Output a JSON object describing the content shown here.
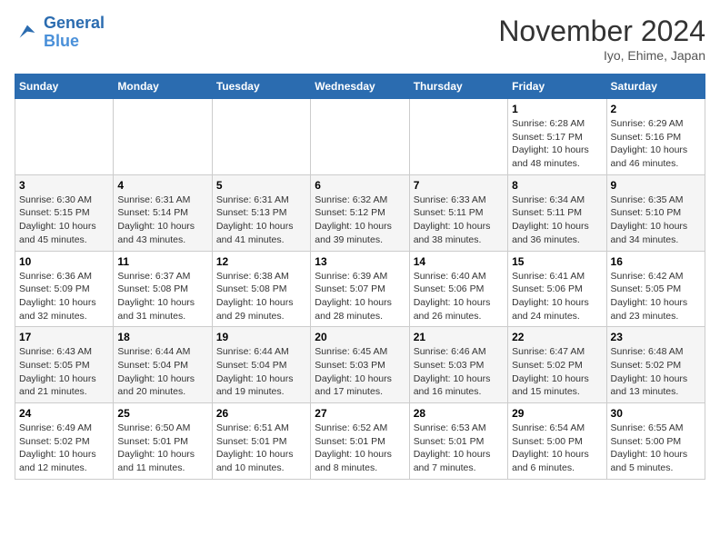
{
  "logo": {
    "line1": "General",
    "line2": "Blue"
  },
  "header": {
    "month": "November 2024",
    "location": "Iyo, Ehime, Japan"
  },
  "weekdays": [
    "Sunday",
    "Monday",
    "Tuesday",
    "Wednesday",
    "Thursday",
    "Friday",
    "Saturday"
  ],
  "weeks": [
    [
      null,
      null,
      null,
      null,
      null,
      {
        "day": "1",
        "sunrise": "6:28 AM",
        "sunset": "5:17 PM",
        "daylight": "10 hours and 48 minutes."
      },
      {
        "day": "2",
        "sunrise": "6:29 AM",
        "sunset": "5:16 PM",
        "daylight": "10 hours and 46 minutes."
      }
    ],
    [
      {
        "day": "3",
        "sunrise": "6:30 AM",
        "sunset": "5:15 PM",
        "daylight": "10 hours and 45 minutes."
      },
      {
        "day": "4",
        "sunrise": "6:31 AM",
        "sunset": "5:14 PM",
        "daylight": "10 hours and 43 minutes."
      },
      {
        "day": "5",
        "sunrise": "6:31 AM",
        "sunset": "5:13 PM",
        "daylight": "10 hours and 41 minutes."
      },
      {
        "day": "6",
        "sunrise": "6:32 AM",
        "sunset": "5:12 PM",
        "daylight": "10 hours and 39 minutes."
      },
      {
        "day": "7",
        "sunrise": "6:33 AM",
        "sunset": "5:11 PM",
        "daylight": "10 hours and 38 minutes."
      },
      {
        "day": "8",
        "sunrise": "6:34 AM",
        "sunset": "5:11 PM",
        "daylight": "10 hours and 36 minutes."
      },
      {
        "day": "9",
        "sunrise": "6:35 AM",
        "sunset": "5:10 PM",
        "daylight": "10 hours and 34 minutes."
      }
    ],
    [
      {
        "day": "10",
        "sunrise": "6:36 AM",
        "sunset": "5:09 PM",
        "daylight": "10 hours and 32 minutes."
      },
      {
        "day": "11",
        "sunrise": "6:37 AM",
        "sunset": "5:08 PM",
        "daylight": "10 hours and 31 minutes."
      },
      {
        "day": "12",
        "sunrise": "6:38 AM",
        "sunset": "5:08 PM",
        "daylight": "10 hours and 29 minutes."
      },
      {
        "day": "13",
        "sunrise": "6:39 AM",
        "sunset": "5:07 PM",
        "daylight": "10 hours and 28 minutes."
      },
      {
        "day": "14",
        "sunrise": "6:40 AM",
        "sunset": "5:06 PM",
        "daylight": "10 hours and 26 minutes."
      },
      {
        "day": "15",
        "sunrise": "6:41 AM",
        "sunset": "5:06 PM",
        "daylight": "10 hours and 24 minutes."
      },
      {
        "day": "16",
        "sunrise": "6:42 AM",
        "sunset": "5:05 PM",
        "daylight": "10 hours and 23 minutes."
      }
    ],
    [
      {
        "day": "17",
        "sunrise": "6:43 AM",
        "sunset": "5:05 PM",
        "daylight": "10 hours and 21 minutes."
      },
      {
        "day": "18",
        "sunrise": "6:44 AM",
        "sunset": "5:04 PM",
        "daylight": "10 hours and 20 minutes."
      },
      {
        "day": "19",
        "sunrise": "6:44 AM",
        "sunset": "5:04 PM",
        "daylight": "10 hours and 19 minutes."
      },
      {
        "day": "20",
        "sunrise": "6:45 AM",
        "sunset": "5:03 PM",
        "daylight": "10 hours and 17 minutes."
      },
      {
        "day": "21",
        "sunrise": "6:46 AM",
        "sunset": "5:03 PM",
        "daylight": "10 hours and 16 minutes."
      },
      {
        "day": "22",
        "sunrise": "6:47 AM",
        "sunset": "5:02 PM",
        "daylight": "10 hours and 15 minutes."
      },
      {
        "day": "23",
        "sunrise": "6:48 AM",
        "sunset": "5:02 PM",
        "daylight": "10 hours and 13 minutes."
      }
    ],
    [
      {
        "day": "24",
        "sunrise": "6:49 AM",
        "sunset": "5:02 PM",
        "daylight": "10 hours and 12 minutes."
      },
      {
        "day": "25",
        "sunrise": "6:50 AM",
        "sunset": "5:01 PM",
        "daylight": "10 hours and 11 minutes."
      },
      {
        "day": "26",
        "sunrise": "6:51 AM",
        "sunset": "5:01 PM",
        "daylight": "10 hours and 10 minutes."
      },
      {
        "day": "27",
        "sunrise": "6:52 AM",
        "sunset": "5:01 PM",
        "daylight": "10 hours and 8 minutes."
      },
      {
        "day": "28",
        "sunrise": "6:53 AM",
        "sunset": "5:01 PM",
        "daylight": "10 hours and 7 minutes."
      },
      {
        "day": "29",
        "sunrise": "6:54 AM",
        "sunset": "5:00 PM",
        "daylight": "10 hours and 6 minutes."
      },
      {
        "day": "30",
        "sunrise": "6:55 AM",
        "sunset": "5:00 PM",
        "daylight": "10 hours and 5 minutes."
      }
    ]
  ]
}
